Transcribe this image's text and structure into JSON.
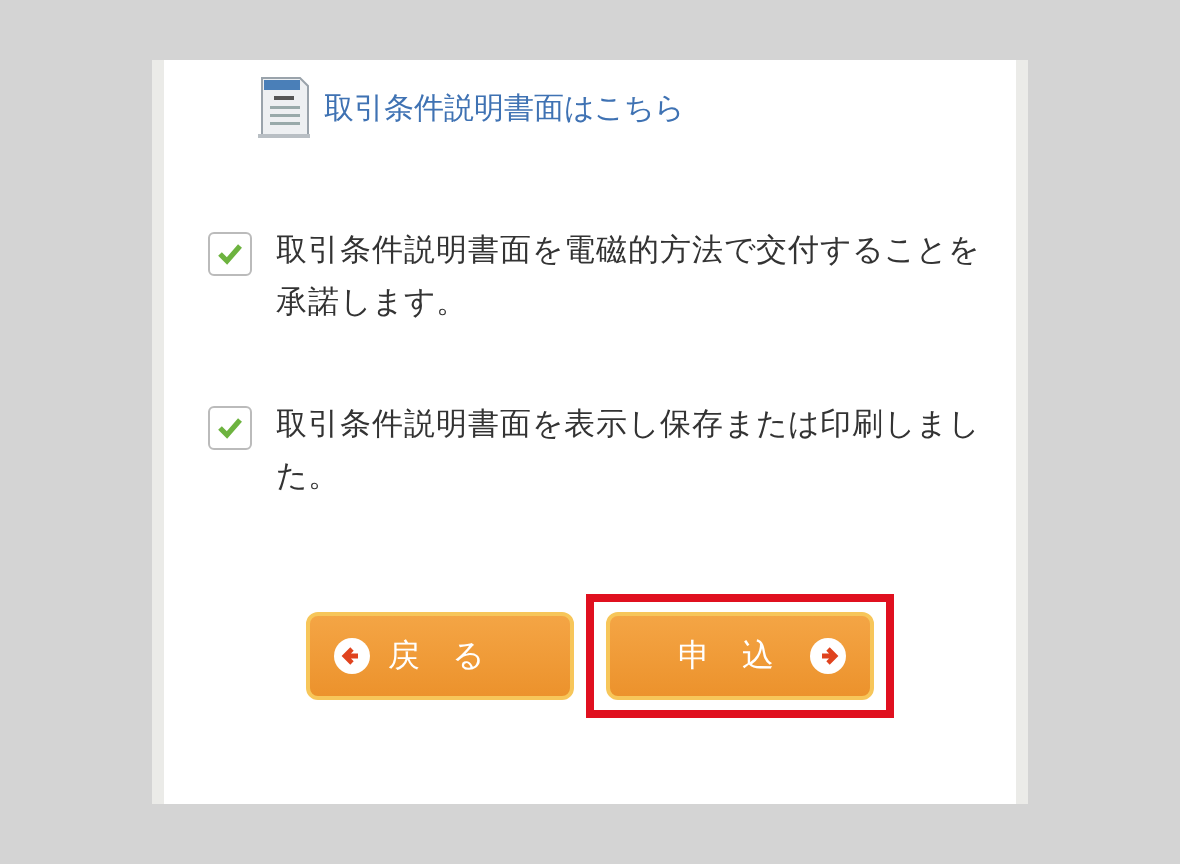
{
  "document_link": {
    "label": "取引条件説明書面はこちら"
  },
  "agreements": [
    {
      "label": "取引条件説明書面を電磁的方法で交付することを承諾します。",
      "checked": true
    },
    {
      "label": "取引条件説明書面を表示し保存または印刷しました。",
      "checked": true
    }
  ],
  "buttons": [
    {
      "kind": "back",
      "label": "戻る",
      "highlighted": false
    },
    {
      "kind": "next",
      "label": "申込",
      "highlighted": true
    }
  ]
}
